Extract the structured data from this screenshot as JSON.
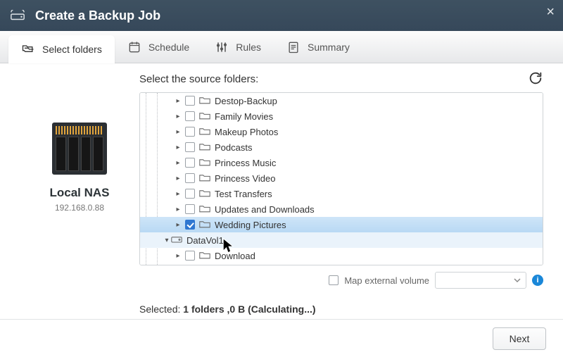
{
  "header": {
    "title": "Create a Backup Job"
  },
  "steps": [
    {
      "label": "Select folders",
      "icon": "overlap-folders-icon",
      "active": true
    },
    {
      "label": "Schedule",
      "icon": "calendar-icon",
      "active": false
    },
    {
      "label": "Rules",
      "icon": "sliders-icon",
      "active": false
    },
    {
      "label": "Summary",
      "icon": "document-icon",
      "active": false
    }
  ],
  "device": {
    "name": "Local NAS",
    "ip": "192.168.0.88"
  },
  "panel": {
    "prompt": "Select the source folders:",
    "map_label": "Map external volume"
  },
  "tree": [
    {
      "type": "folder",
      "indent": 3,
      "label": "Destop-Backup",
      "checked": false,
      "expand": "closed"
    },
    {
      "type": "folder",
      "indent": 3,
      "label": "Family Movies",
      "checked": false,
      "expand": "closed"
    },
    {
      "type": "folder",
      "indent": 3,
      "label": "Makeup Photos",
      "checked": false,
      "expand": "closed"
    },
    {
      "type": "folder",
      "indent": 3,
      "label": "Podcasts",
      "checked": false,
      "expand": "closed"
    },
    {
      "type": "folder",
      "indent": 3,
      "label": "Princess Music",
      "checked": false,
      "expand": "closed"
    },
    {
      "type": "folder",
      "indent": 3,
      "label": "Princess Video",
      "checked": false,
      "expand": "closed"
    },
    {
      "type": "folder",
      "indent": 3,
      "label": "Test Transfers",
      "checked": false,
      "expand": "closed"
    },
    {
      "type": "folder",
      "indent": 3,
      "label": "Updates and Downloads",
      "checked": false,
      "expand": "closed"
    },
    {
      "type": "folder",
      "indent": 3,
      "label": "Wedding Pictures",
      "checked": true,
      "expand": "closed",
      "selected": true
    },
    {
      "type": "volume",
      "indent": 2,
      "label": "DataVol1",
      "expand": "open",
      "volrow": true
    },
    {
      "type": "folder",
      "indent": 3,
      "label": "Download",
      "checked": false,
      "expand": "closed"
    }
  ],
  "status": {
    "prefix": "Selected: ",
    "bold": "1 folders ,0 B (Calculating...)"
  },
  "footer": {
    "next": "Next"
  }
}
